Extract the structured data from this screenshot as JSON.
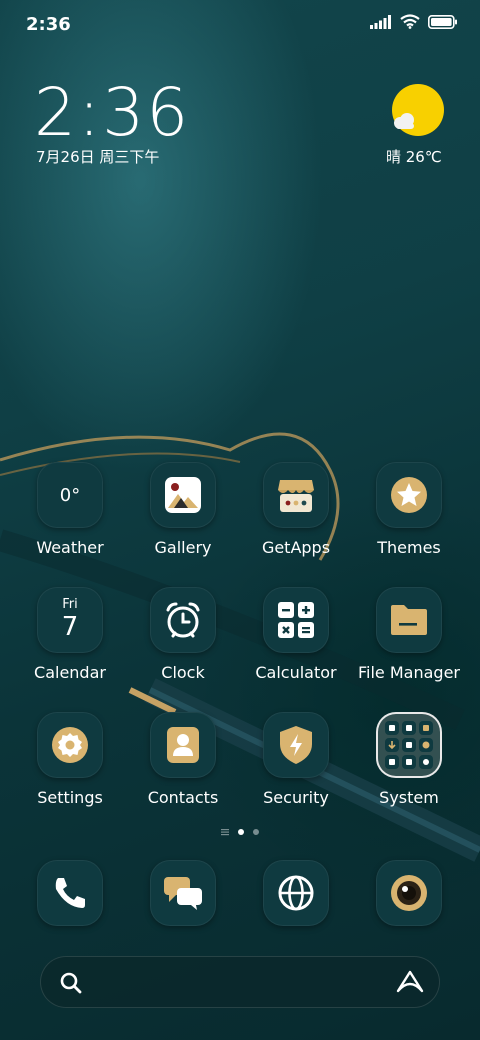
{
  "status": {
    "time": "2:36"
  },
  "clock_widget": {
    "time": "2:36",
    "date": "7月26日 周三下午"
  },
  "weather_widget": {
    "text": "晴 26℃",
    "icon": "sunny-cloud-icon"
  },
  "apps": {
    "weather": {
      "label": "Weather",
      "value": "0°"
    },
    "gallery": {
      "label": "Gallery"
    },
    "getapps": {
      "label": "GetApps"
    },
    "themes": {
      "label": "Themes"
    },
    "calendar": {
      "label": "Calendar",
      "day": "Fri",
      "date": "7"
    },
    "clock": {
      "label": "Clock"
    },
    "calculator": {
      "label": "Calculator"
    },
    "file_manager": {
      "label": "File Manager"
    },
    "settings": {
      "label": "Settings"
    },
    "contacts": {
      "label": "Contacts"
    },
    "security": {
      "label": "Security"
    },
    "system": {
      "label": "System"
    }
  },
  "dock": [
    "phone-icon",
    "messages-icon",
    "browser-icon",
    "camera-icon"
  ],
  "colors": {
    "accent": "#d9b470",
    "tile": "#0f3a40",
    "sun": "#f8d000"
  }
}
